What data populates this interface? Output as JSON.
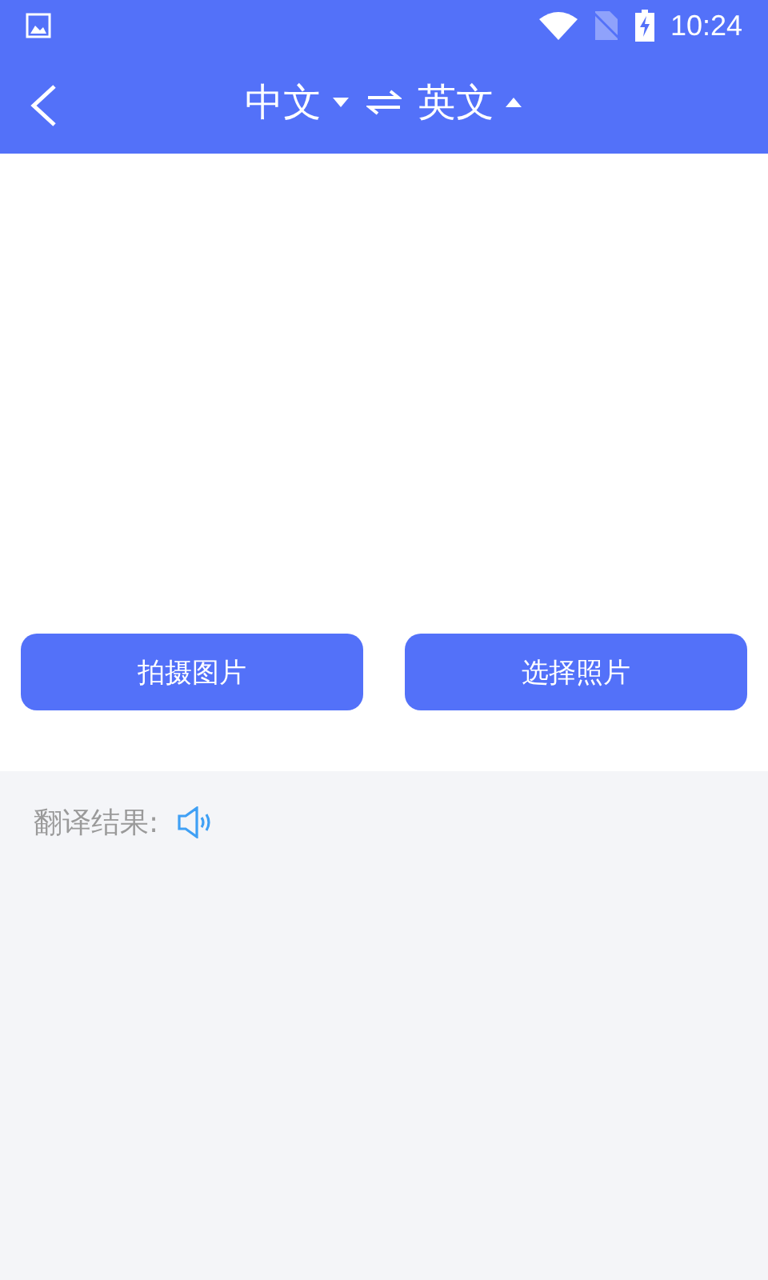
{
  "status_bar": {
    "time": "10:24"
  },
  "header": {
    "source": {
      "label": "中文",
      "expanded": false
    },
    "target": {
      "label": "英文",
      "expanded": true
    }
  },
  "buttons": [
    {
      "label": "拍摄图片"
    },
    {
      "label": "选择照片"
    }
  ],
  "result": {
    "label": "翻译结果:"
  }
}
